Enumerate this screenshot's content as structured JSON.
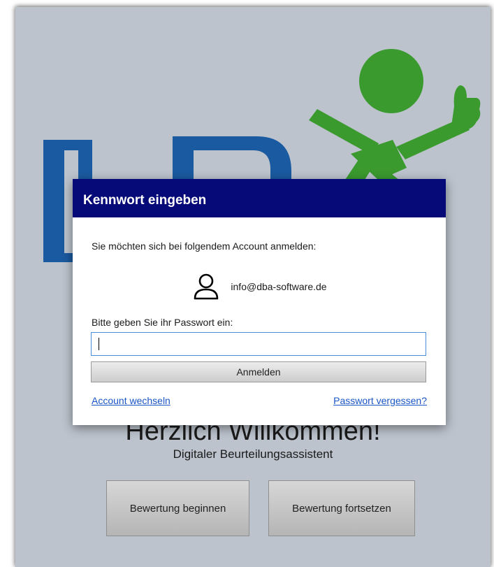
{
  "colors": {
    "background": "#bcc3cd",
    "logo_blue": "#1a5aa0",
    "logo_green": "#3a9a2e",
    "dialog_header": "#050a78",
    "link": "#1a56c6"
  },
  "main": {
    "welcome_title": "Herzlich Willkommen!",
    "subtitle": "Digitaler Beurteilungsassistent",
    "buttons": {
      "begin": "Bewertung beginnen",
      "continue": "Bewertung fortsetzen"
    }
  },
  "dialog": {
    "title": "Kennwort eingeben",
    "prompt": "Sie möchten sich bei folgendem Account anmelden:",
    "account_icon": "user-icon",
    "account_email": "info@dba-software.de",
    "password_label": "Bitte geben Sie ihr Passwort ein:",
    "password_value": "",
    "login_button": "Anmelden",
    "switch_account_link": "Account wechseln",
    "forgot_password_link": "Passwort vergessen?"
  }
}
